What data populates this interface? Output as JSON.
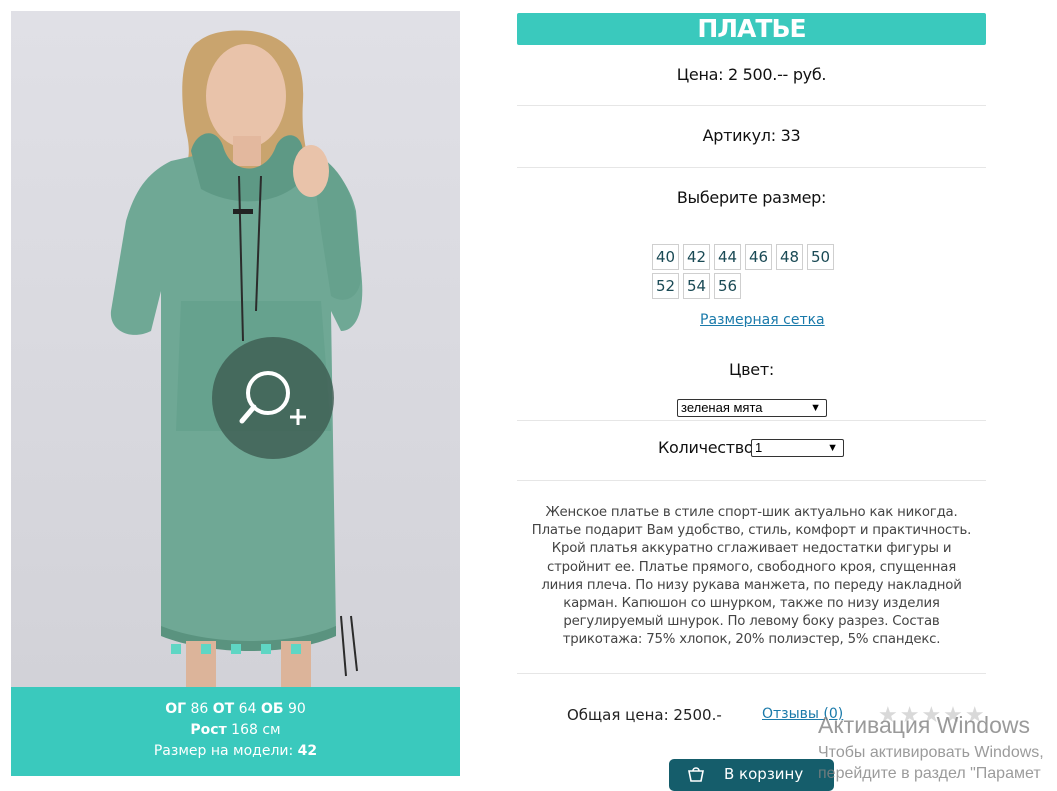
{
  "product": {
    "title": "ПЛАТЬЕ",
    "price": "Цена: 2 500.-- руб.",
    "article": "Артикул: 33",
    "choose_size": "Выберите размер:",
    "sizes": [
      "40",
      "42",
      "44",
      "46",
      "48",
      "50",
      "52",
      "54",
      "56"
    ],
    "size_chart_link": "Размерная сетка",
    "color_label": "Цвет:",
    "color_selected": "зеленая мята",
    "quantity_label": "Количество:",
    "quantity_selected": "1",
    "description": "Женское платье в стиле спорт-шик актуально как никогда. Платье подарит Вам удобство, стиль, комфорт и практичность. Крой платья аккуратно сглаживает недостатки фигуры и стройнит ее. Платье прямого, свободного кроя, спущенная линия плеча. По низу рукава манжета, по переду накладной карман. Капюшон со шнурком, также по низу изделия регулируемый шнурок. По левому боку разрез. Состав трикотажа: 75% хлопок, 20% полиэстер, 5% спандекс.",
    "total": "Общая цена: 2500.-",
    "reviews": "Отзывы (0)",
    "stars": "★★★★★",
    "cart_button": "В корзину"
  },
  "model": {
    "og_label": "ОГ",
    "og_value": "86",
    "ot_label": "ОТ",
    "ot_value": "64",
    "ob_label": "ОБ",
    "ob_value": "90",
    "height_label": "Рост",
    "height_value": "168 см",
    "size_label": "Размер на модели:",
    "size_value": "42"
  },
  "windows": {
    "title": "Активация Windows",
    "line1": "Чтобы активировать Windows,",
    "line2": "перейдите в раздел \"Парамет"
  },
  "colors": {
    "accent": "#3ac9bd",
    "button": "#155d6b",
    "link": "#1a7aaa"
  }
}
